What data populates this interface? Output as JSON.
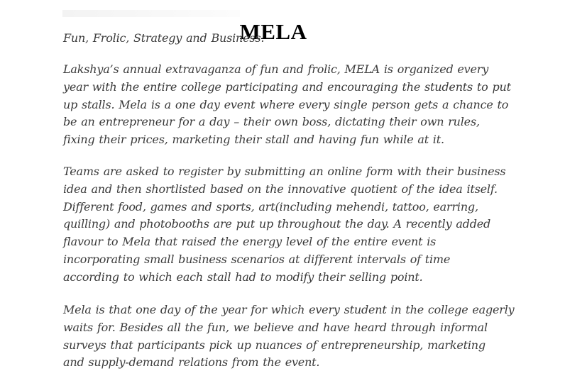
{
  "document": {
    "title": "MELA",
    "subtitle": "Fun, Frolic, Strategy and Business.",
    "paragraphs": [
      [
        "Lakshya’s annual extravaganza of fun and frolic, MELA is organized every",
        "year with the entire college participating and encouraging the students to put",
        "up stalls. Mela is a one day event where every single person gets a chance to",
        "be an entrepreneur for a day – their own boss, dictating their own rules,",
        "fixing their prices, marketing their stall and having fun while at it."
      ],
      [
        "Teams are asked to register by submitting an online form with their business",
        "idea and then shortlisted based on the innovative quotient of the idea itself.",
        "Different food, games and sports, art(including mehendi, tattoo, earring,",
        "quilling) and photobooths are put up throughout the day. A recently added",
        "flavour to Mela that raised the energy level of the entire event is",
        "incorporating small business scenarios at different intervals of time",
        "according to which each stall had to modify their selling point."
      ],
      [
        "Mela is that one day of the year for which every student in the college eagerly",
        "waits for. Besides all the fun, we believe and have heard through informal",
        "surveys that participants pick up nuances of entrepreneurship, marketing",
        "and supply-demand relations from the event."
      ]
    ]
  }
}
